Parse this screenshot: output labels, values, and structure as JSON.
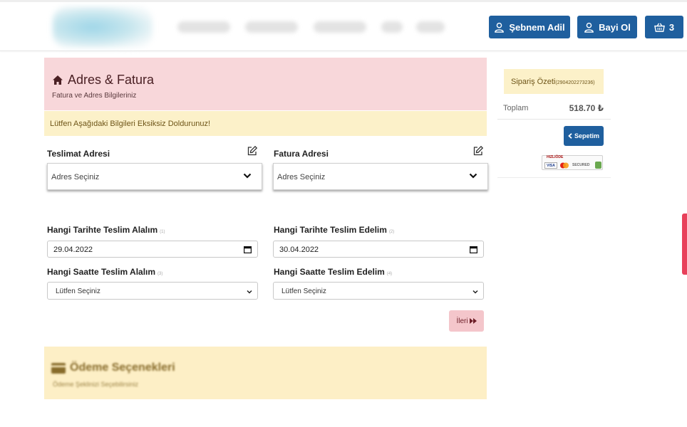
{
  "header": {
    "user_button": "Şebnem Adil",
    "dealer_button": "Bayi Ol",
    "cart_count": "3",
    "brand_color": "#1f5f9e"
  },
  "address_panel": {
    "title": "Adres & Fatura",
    "subtitle": "Fatura ve Adres Bilgileriniz",
    "warning": "Lütfen Aşağıdaki Bilgileri Eksiksiz Doldurunuz!"
  },
  "delivery_address": {
    "label": "Teslimat Adresi",
    "value": "Adres Seçiniz"
  },
  "invoice_address": {
    "label": "Fatura Adresi",
    "value": "Adres Seçiniz"
  },
  "receive_date": {
    "label": "Hangi Tarihte Teslim Alalım",
    "step": "(1)",
    "value": "29.04.2022"
  },
  "deliver_date": {
    "label": "Hangi Tarihte Teslim Edelim",
    "step": "(2)",
    "value": "30.04.2022"
  },
  "receive_time": {
    "label": "Hangi Saatte Teslim Alalım",
    "step": "(3)",
    "value": "Lütfen Seçiniz"
  },
  "deliver_time": {
    "label": "Hangi Saatte Teslim Edelim",
    "step": "(4)",
    "value": "Lütfen Seçiniz"
  },
  "next_button": "İleri",
  "payment_panel": {
    "title": "Ödeme Seçenekleri",
    "subtitle": "Ödeme Şeklinizi Seçebilirsiniz"
  },
  "order_summary": {
    "title": "Sipariş Özeti",
    "order_no": "(2904202273236)",
    "total_label": "Toplam",
    "total_value": "518.70 ₺",
    "cart_button": "Sepetim",
    "secure_badge_text": "HIZLIÖDE",
    "visa_text": "VISA",
    "secured_text": "SECURED"
  }
}
